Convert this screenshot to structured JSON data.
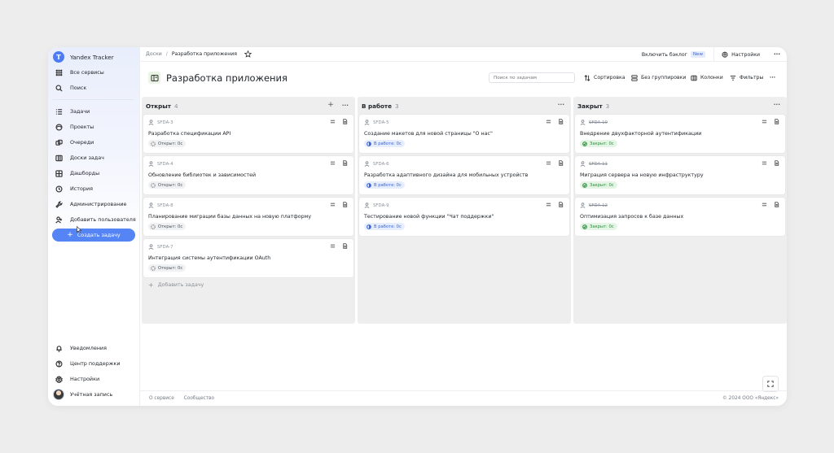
{
  "app": {
    "name": "Yandex Tracker",
    "logo_letter": "T"
  },
  "sidebar": {
    "top_items": [
      {
        "label": "Все сервисы",
        "icon": "grid-icon"
      },
      {
        "label": "Поиск",
        "icon": "search-icon"
      }
    ],
    "items": [
      {
        "label": "Задачи",
        "icon": "list-icon"
      },
      {
        "label": "Проекты",
        "icon": "projects-icon"
      },
      {
        "label": "Очереди",
        "icon": "queues-icon"
      },
      {
        "label": "Доски задач",
        "icon": "board-icon"
      },
      {
        "label": "Дашборды",
        "icon": "dashboard-icon"
      },
      {
        "label": "История",
        "icon": "history-icon"
      },
      {
        "label": "Администрирование",
        "icon": "wrench-icon"
      },
      {
        "label": "Добавить пользователя",
        "icon": "add-user-icon"
      }
    ],
    "create_button": "Создать задачу",
    "bottom_items": [
      {
        "label": "Уведомления",
        "icon": "bell-icon"
      },
      {
        "label": "Центр поддержки",
        "icon": "help-icon"
      },
      {
        "label": "Настройки",
        "icon": "gear-icon"
      },
      {
        "label": "Учётная запись",
        "icon": "avatar"
      }
    ]
  },
  "topbar": {
    "breadcrumb_root": "Доски",
    "breadcrumb_sep": "/",
    "breadcrumb_current": "Разработка приложения",
    "backlog_label": "Включить бэклог",
    "new_badge": "New",
    "settings_label": "Настройки",
    "more": "···"
  },
  "header": {
    "title": "Разработка приложения",
    "search_placeholder": "Поиск по задачам",
    "sort_label": "Сортировка",
    "group_label": "Без группировки",
    "columns_label": "Колонки",
    "filters_label": "Фильтры",
    "more": "···"
  },
  "columns": [
    {
      "title": "Открыт",
      "count": "4",
      "more": "···",
      "add_label": "Добавить задачу",
      "cards": [
        {
          "key": "SFDA-3",
          "title": "Разработка спецификации API",
          "status": "Открыт: 0с"
        },
        {
          "key": "SFDA-4",
          "title": "Обновление библиотек и зависимостей",
          "status": "Открыт: 0с"
        },
        {
          "key": "SFDA-8",
          "title": "Планирование миграции базы данных на новую платформу",
          "status": "Открыт: 0с"
        },
        {
          "key": "SFDA-7",
          "title": "Интеграция системы аутентификации OAuth",
          "status": "Открыт: 0с"
        }
      ]
    },
    {
      "title": "В работе",
      "count": "3",
      "more": "···",
      "cards": [
        {
          "key": "SFDA-5",
          "title": "Создание макетов для новой страницы \"О нас\"",
          "status": "В работе: 0с"
        },
        {
          "key": "SFDA-6",
          "title": "Разработка адаптивного дизайна для мобильных устройств",
          "status": "В работе: 0с"
        },
        {
          "key": "SFDA-9",
          "title": "Тестирование новой функции \"Чат поддержки\"",
          "status": "В работе: 0с"
        }
      ]
    },
    {
      "title": "Закрыт",
      "count": "3",
      "more": "···",
      "cards": [
        {
          "key": "SFDA-10",
          "title": "Внедрение двухфакторной аутентификации",
          "status": "Закрыт: 0с"
        },
        {
          "key": "SFDA-11",
          "title": "Миграция сервера на новую инфраструктуру",
          "status": "Закрыт: 0с"
        },
        {
          "key": "SFDA-12",
          "title": "Оптимизация запросов к базе данных",
          "status": "Закрыт: 0с"
        }
      ]
    }
  ],
  "footer": {
    "about": "О сервисе",
    "community": "Сообщество",
    "copyright": "© 2024 ООО «Яндекс»"
  },
  "colors": {
    "accent": "#5584f4",
    "open_badge": "#f0f1f3",
    "work_badge": "#e6edfd",
    "done_badge": "#e4f5e5"
  }
}
